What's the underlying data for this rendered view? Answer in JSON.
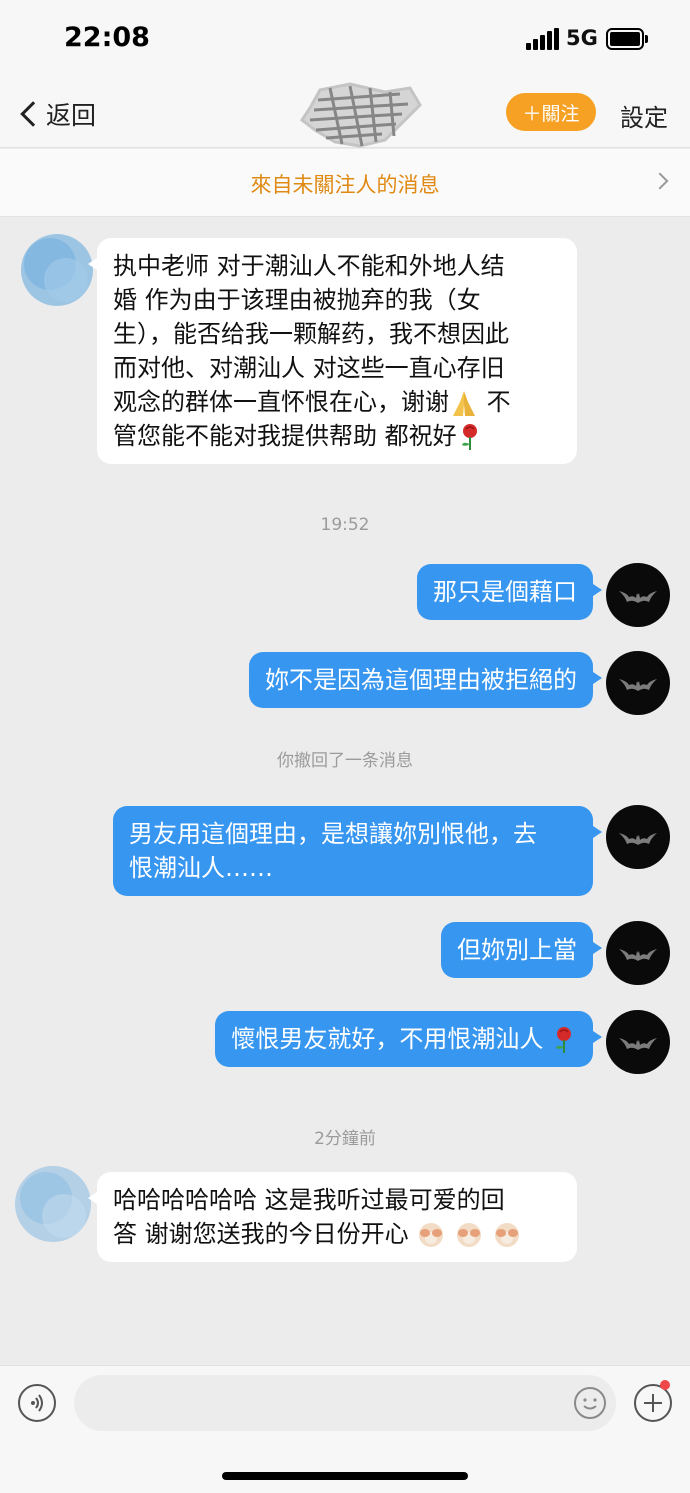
{
  "status_bar": {
    "time": "22:08",
    "network": "5G"
  },
  "nav": {
    "back_label": "返回",
    "follow_label": "＋關注",
    "settings_label": "設定"
  },
  "notice": {
    "text": "來自未關注人的消息"
  },
  "messages": {
    "m1": {
      "lines": [
        "执中老师 对于潮汕人不能和外地人结",
        "婚 作为由于该理由被抛弃的我（女",
        "生），能否给我一颗解药，我不想因此",
        "而对他、对潮汕人 对这些一直心存旧",
        "观念的群体一直怀恨在心，谢谢",
        "管您能不能对我提供帮助 都祝好"
      ],
      "line5_tail": "不"
    },
    "time1": "19:52",
    "m2": "那只是個藉口",
    "m3": "妳不是因為這個理由被拒絕的",
    "recall": "你撤回了一条消息",
    "m4": {
      "lines": [
        "男友用這個理由，是想讓妳別恨他，去",
        "恨潮汕人……"
      ]
    },
    "m5": "但妳別上當",
    "m6": "懷恨男友就好，不用恨潮汕人",
    "time2": "2分鐘前",
    "m7": {
      "lines": [
        "哈哈哈哈哈哈 这是我听过最可爱的回",
        "答 谢谢您送我的今日份开心"
      ]
    }
  },
  "icons": {
    "voice": "voice-icon",
    "emoji": "smiley-icon",
    "plus": "plus-icon",
    "pray": "praying-hands-icon",
    "rose": "rose-icon",
    "monkey": "see-no-evil-monkey-icon",
    "bat": "bat-logo-icon"
  },
  "colors": {
    "accent": "#f6a123",
    "bubble_out": "#3796f0",
    "notice": "#e08a13"
  }
}
